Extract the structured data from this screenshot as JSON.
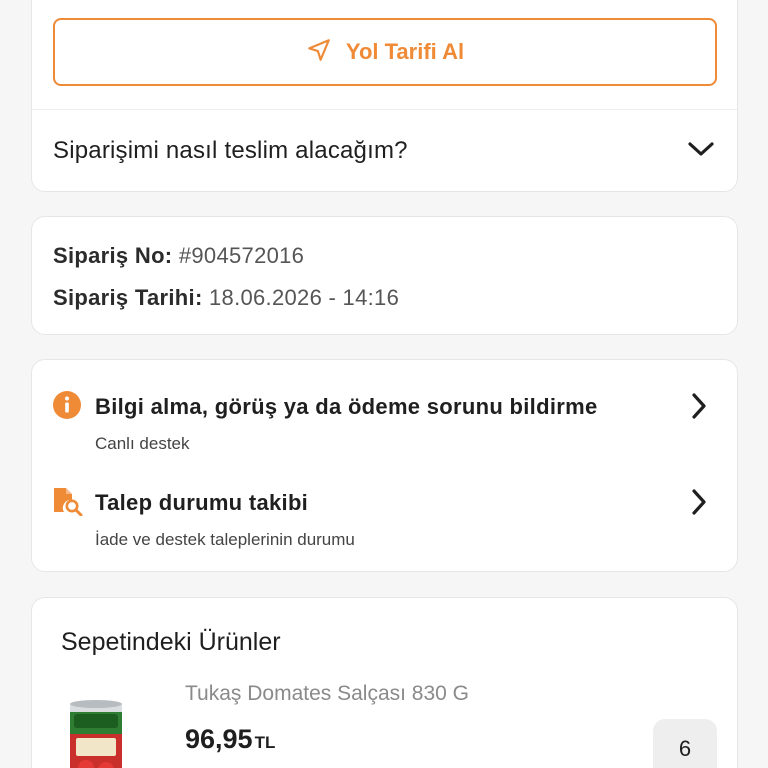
{
  "directions": {
    "label": "Yol Tarifi Al",
    "icon": "navigation-arrow-icon"
  },
  "delivery_accordion": {
    "question": "Siparişimi nasıl teslim alacağım?",
    "icon": "chevron-down-icon"
  },
  "order": {
    "number_label": "Sipariş No:",
    "number_value": "#904572016",
    "date_label": "Sipariş Tarihi:",
    "date_value": "18.06.2026 - 14:16"
  },
  "support": [
    {
      "title": "Bilgi alma, görüş ya da ödeme sorunu bildirme",
      "subtitle": "Canlı destek",
      "icon": "info-circle-icon"
    },
    {
      "title": "Talep durumu takibi",
      "subtitle": "İade ve destek taleplerinin durumu",
      "icon": "document-search-icon"
    }
  ],
  "cart": {
    "title": "Sepetindeki Ürünler",
    "items": [
      {
        "name": "Tukaş Domates Salçası 830 G",
        "price": "96,95",
        "currency": "TL",
        "quantity": "6",
        "image_icon": "tomato-paste-can-image"
      }
    ]
  },
  "colors": {
    "accent": "#ef8a37",
    "background": "#f6f6f6",
    "card": "#ffffff"
  }
}
